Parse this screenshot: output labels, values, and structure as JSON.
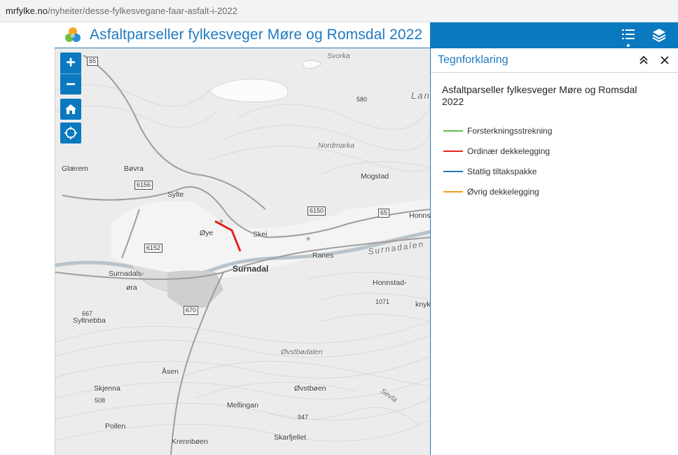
{
  "browser": {
    "domain": "mrfylke.no",
    "path": "/nyheiter/desse-fylkesvegane-faar-asfalt-i-2022"
  },
  "app": {
    "title": "Asfaltparseller fylkesveger Møre og Romsdal 2022",
    "logo_icon": "colored-circles-logo-icon"
  },
  "toolbar": {
    "legend_icon": "list-icon",
    "layers_icon": "layers-icon"
  },
  "map_controls": {
    "zoom_in": "+",
    "zoom_out": "−",
    "home_icon": "home-icon",
    "locate_icon": "locate-icon"
  },
  "map": {
    "place_labels": [
      {
        "id": "svorka",
        "text": "Svorka"
      },
      {
        "id": "lan",
        "text": "Lan"
      },
      {
        "id": "h580",
        "text": "580"
      },
      {
        "id": "nordmarka",
        "text": "Nordmarka"
      },
      {
        "id": "glaerem",
        "text": "Glærem"
      },
      {
        "id": "bovra",
        "text": "Bøvra"
      },
      {
        "id": "sylte",
        "text": "Sylte"
      },
      {
        "id": "mogstad",
        "text": "Mogstad"
      },
      {
        "id": "honns",
        "text": "Honns"
      },
      {
        "id": "oye",
        "text": "Øye"
      },
      {
        "id": "skei",
        "text": "Skei"
      },
      {
        "id": "ranes",
        "text": "Ranes"
      },
      {
        "id": "surnadalen",
        "text": "Surnadalen"
      },
      {
        "id": "surnadal",
        "text": "Surnadal"
      },
      {
        "id": "surnadalsora1",
        "text": "Surnadals-"
      },
      {
        "id": "surnadalsora2",
        "text": "øra"
      },
      {
        "id": "honnstad",
        "text": "Honnstad-"
      },
      {
        "id": "h1071",
        "text": "1071"
      },
      {
        "id": "knyk",
        "text": "knyk"
      },
      {
        "id": "h667",
        "text": "667"
      },
      {
        "id": "syltnebba",
        "text": "Syltnebba"
      },
      {
        "id": "ovstbodalen",
        "text": "Øvstbødalen"
      },
      {
        "id": "asen",
        "text": "Åsen"
      },
      {
        "id": "skjenna",
        "text": "Skjenna"
      },
      {
        "id": "ovstboen",
        "text": "Øvstbøen"
      },
      {
        "id": "h508",
        "text": "508"
      },
      {
        "id": "mellingan",
        "text": "Mellingan"
      },
      {
        "id": "sevla",
        "text": "Sevla"
      },
      {
        "id": "h947",
        "text": "947"
      },
      {
        "id": "pollen",
        "text": "Pollen"
      },
      {
        "id": "skarfjellet",
        "text": "Skarfjellet"
      },
      {
        "id": "krennboen",
        "text": "Krennbøen"
      }
    ],
    "road_numbers": [
      {
        "id": "r65a",
        "text": "65"
      },
      {
        "id": "r6156",
        "text": "6156"
      },
      {
        "id": "r6150",
        "text": "6150"
      },
      {
        "id": "r65b",
        "text": "65"
      },
      {
        "id": "r6152",
        "text": "6152"
      },
      {
        "id": "r670",
        "text": "670"
      }
    ]
  },
  "legend_panel": {
    "title": "Tegnforklaring",
    "collapse_icon": "double-chevron-up-icon",
    "close_icon": "close-icon",
    "layer_title": "Asfaltparseller fylkesveger Møre og Romsdal 2022",
    "items": [
      {
        "label": "Forsterkningsstrekning",
        "color": "#5fbe45"
      },
      {
        "label": "Ordinær dekkelegging",
        "color": "#e0261d"
      },
      {
        "label": "Statlig tiltakspakke",
        "color": "#1f7ac2"
      },
      {
        "label": "Øvrig dekkelegging",
        "color": "#f39a1f"
      }
    ]
  }
}
